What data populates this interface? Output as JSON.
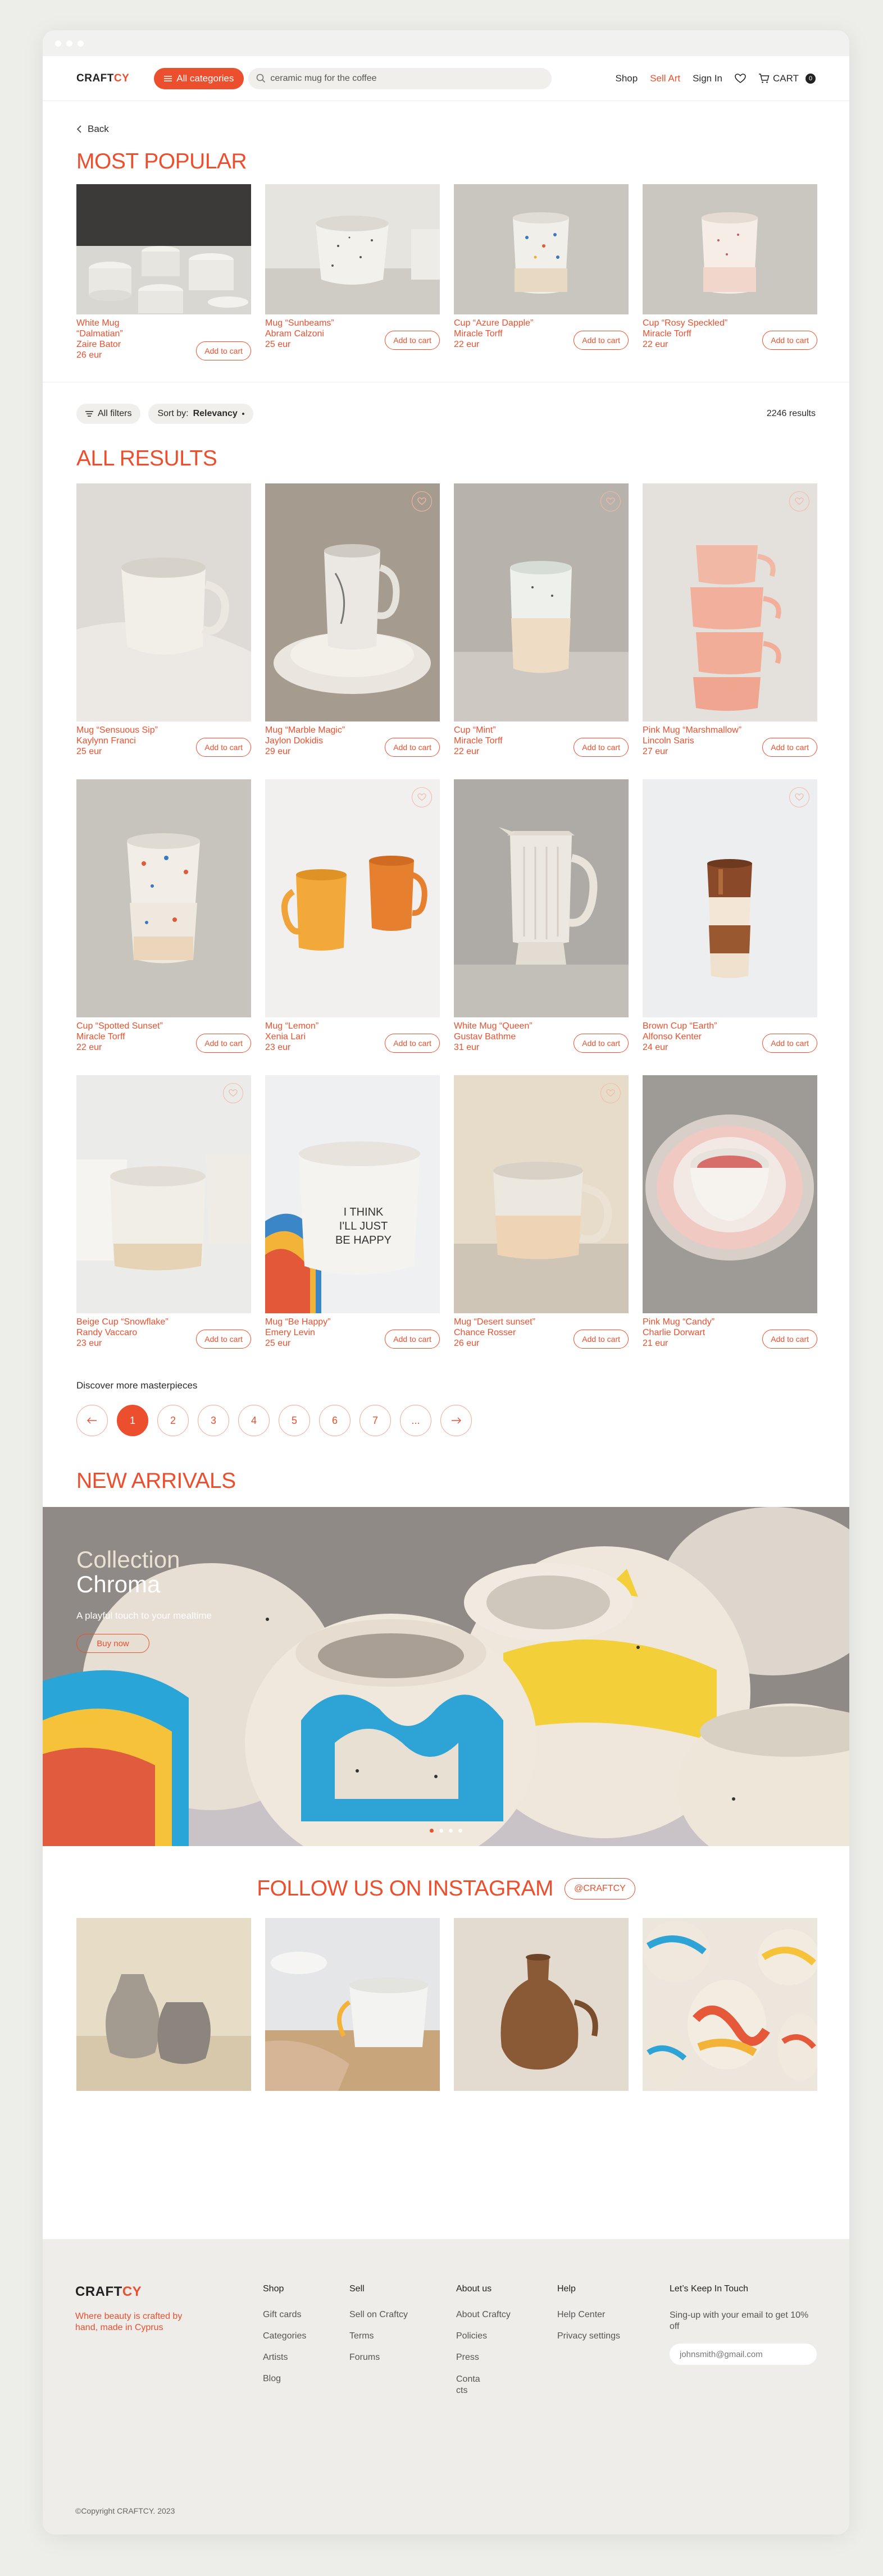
{
  "header": {
    "logo_main": "CRAFT",
    "logo_accent": "CY",
    "categories_label": "All categories",
    "search_value": "ceramic mug for the coffee",
    "nav": {
      "shop": "Shop",
      "sell": "Sell Art",
      "signin": "Sign In",
      "cart": "CART",
      "cart_count": "0"
    }
  },
  "back_label": "Back",
  "popular": {
    "title": "MOST POPULAR",
    "items": [
      {
        "title": "White Mug “Dalmatian”",
        "artist": "Zaire Bator",
        "price": "26 eur"
      },
      {
        "title": "Mug “Sunbeams”",
        "artist": "Abram Calzoni",
        "price": "25 eur"
      },
      {
        "title": "Cup “Azure Dapple”",
        "artist": "Miracle Torff",
        "price": "22 eur"
      },
      {
        "title": "Cup “Rosy Speckled”",
        "artist": "Miracle Torff",
        "price": "22 eur"
      }
    ]
  },
  "add_to_cart": "Add to cart",
  "filters": {
    "all_filters": "All filters",
    "sort_prefix": "Sort by:",
    "sort_value": "Relevancy",
    "results": "2246 results"
  },
  "results": {
    "title": "ALL RESULTS",
    "items": [
      {
        "title": "Mug “Sensuous Sip”",
        "artist": "Kaylynn Franci",
        "price": "25 eur"
      },
      {
        "title": "Mug “Marble Magic”",
        "artist": "Jaylon Dokidis",
        "price": "29 eur"
      },
      {
        "title": "Cup “Mint”",
        "artist": "Miracle Torff",
        "price": "22 eur"
      },
      {
        "title": "Pink Mug “Marshmallow”",
        "artist": "Lincoln Saris",
        "price": "27 eur"
      },
      {
        "title": "Cup “Spotted Sunset”",
        "artist": "Miracle Torff",
        "price": "22 eur"
      },
      {
        "title": "Mug “Lemon”",
        "artist": "Xenia Lari",
        "price": "23 eur"
      },
      {
        "title": "White Mug “Queen”",
        "artist": "Gustav Bathme",
        "price": "31 eur"
      },
      {
        "title": "Brown Cup “Earth”",
        "artist": "Alfonso Kenter",
        "price": "24 eur"
      },
      {
        "title": "Beige Cup “Snowflake”",
        "artist": "Randy Vaccaro",
        "price": "23 eur"
      },
      {
        "title": "Mug “Be Happy”",
        "artist": "Emery Levin",
        "price": "25 eur"
      },
      {
        "title": "Mug “Desert sunset”",
        "artist": "Chance Rosser",
        "price": "26 eur"
      },
      {
        "title": "Pink Mug “Candy”",
        "artist": "Charlie Dorwart",
        "price": "21 eur"
      }
    ]
  },
  "pagination": {
    "label": "Discover more masterpieces",
    "pages": [
      "1",
      "2",
      "3",
      "4",
      "5",
      "6",
      "7",
      "..."
    ],
    "active": "1"
  },
  "arrivals": {
    "title": "NEW ARRIVALS",
    "eyebrow": "Collection",
    "name": "Chroma",
    "subtitle": "A playful touch to your mealtime",
    "button": "Buy now"
  },
  "instagram": {
    "title": "FOLLOW US ON INSTAGRAM",
    "handle": "@CRAFTCY"
  },
  "footer": {
    "tagline": "Where beauty is crafted by hand, made in Cyprus",
    "shop": {
      "title": "Shop",
      "links": [
        "Gift cards",
        "Categories",
        "Artists",
        "Blog"
      ]
    },
    "sell": {
      "title": "Sell",
      "links": [
        "Sell on Craftcy",
        "Terms",
        "Forums"
      ]
    },
    "about": {
      "title": "About us",
      "links": [
        "About Craftcy",
        "Policies",
        "Press",
        "Conta cts"
      ]
    },
    "help": {
      "title": "Help",
      "links": [
        "Help Center",
        "Privacy settings"
      ]
    },
    "news": {
      "title": "Let’s Keep In Touch",
      "text": "Sing-up with your email to get 10% off",
      "email_placeholder": "johnsmith@gmail.com"
    },
    "copyright": "©Copyright CRAFTCY. 2023"
  },
  "colors": {
    "accent": "#ec4f2d",
    "background": "#ededea",
    "footer": "#eeede9"
  }
}
